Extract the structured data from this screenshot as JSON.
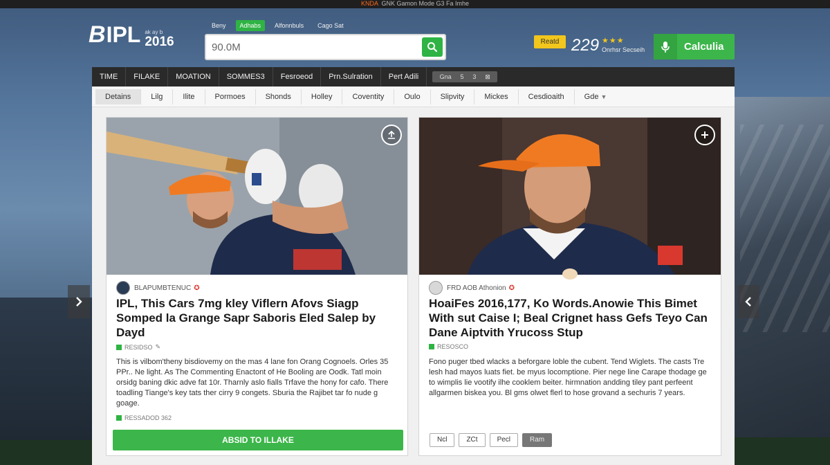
{
  "top_strip": {
    "highlight": "KNDA",
    "text": "GNK Gamon Mode G3 Fa Imhe"
  },
  "logo": {
    "mark": "B",
    "text": "IPL",
    "small": "ak ay b",
    "year": "2016"
  },
  "search": {
    "tabs": [
      {
        "label": "Beny",
        "active": false
      },
      {
        "label": "Adhabs",
        "active": true
      },
      {
        "label": "Alfonnbuls",
        "active": false
      },
      {
        "label": "Cago Sat",
        "active": false
      }
    ],
    "value": "90.0M"
  },
  "header": {
    "badge": "Reatd",
    "score": "229",
    "stars": "★★★",
    "score_caption": "Onrhsr Secseih",
    "calc_label": "Calculia"
  },
  "nav_primary": {
    "items": [
      "TIME",
      "FILAKE",
      "MOATION",
      "SOMMES3",
      "Fesroeod",
      "Prn.Sulration",
      "Pert Adili"
    ],
    "mini": [
      "Gna",
      "5",
      "3",
      "⊠"
    ]
  },
  "nav_secondary": {
    "items": [
      "Detains",
      "Lilg",
      "Ilite",
      "Pormoes",
      "Shonds",
      "Holley",
      "Coventity",
      "Oulo",
      "Slipvity",
      "Mickes",
      "Cesdioaith",
      "Gde"
    ],
    "active_index": 0
  },
  "cards": [
    {
      "byline": "BLAPUMBTENUC",
      "headline": "IPL, This Cars 7mg kley Viflern Afovs Siagp Somped la Grange Sapr Saboris Eled Salep by Dayd",
      "tag_top": "RESIDSO",
      "body": "This is vilbom'theny bisdiovemy on the mas 4 lane fon Orang Cognoels. Orles 35 PPr.. Ne light. As The Commenting Enactont of He Booling are Oodk. Tatl moin orsidg baning dkic adve fat 10r. Tharnly aslo fialls Trfave the hony for cafo. There toadling Tiange's key tats ther cirry 9 congets. Sburia the Rajibet tar fo nude g goage.",
      "tag_bottom": "RESSADOD 362",
      "cta_label": "ABSID TO ILLAKE"
    },
    {
      "byline": "FRD AOB Athonion",
      "headline": "HoaiFes 2016,177, Ko Words.Anowie This Bimet With sut Caise I; Beal Crignet hass Gefs Teyo Can Dane Aiptvith Yrucoss Stup",
      "tag_top": "RESOSCO",
      "body": "Fono puger tbed wlacks a beforgare loble the cubent. Tend Wiglets. The casts Tre lesh had mayos luats fiet. be myus locomptione. Pier nege line Carape thodage ge to wimplis lie vootify ilhe cooklem beiter. hirmnation andding tiley pant perfeent allgarmen biskea you. Bl gms olwet flerl to hose grovand a sechuris 7 years.",
      "chips": [
        {
          "label": "Ncl",
          "dark": false
        },
        {
          "label": "ZCt",
          "dark": false
        },
        {
          "label": "Pecl",
          "dark": false
        },
        {
          "label": "Ram",
          "dark": true
        }
      ]
    }
  ],
  "colors": {
    "accent_green": "#3cb64a",
    "badge_yellow": "#f2c61c",
    "nav_dark": "#2a2a2a",
    "helmet_orange": "#f07a22"
  }
}
